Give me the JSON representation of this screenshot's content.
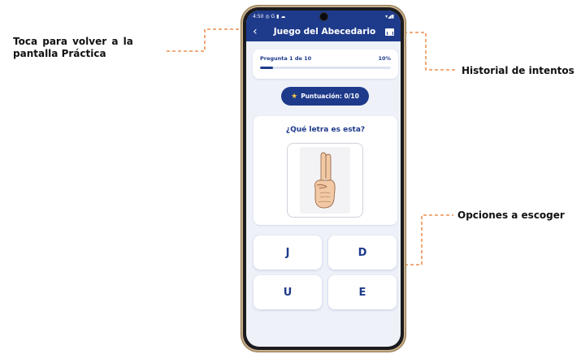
{
  "annotations": {
    "back_line1": "Toca para volver a la",
    "back_line2": "pantalla Práctica",
    "history": "Historial de intentos",
    "options": "Opciones a escoger",
    "guide_color": "#e8792e"
  },
  "status_bar": {
    "time": "4:50",
    "left_icons": "◎ G ▮ ☁",
    "right_icons": "▾◢▮"
  },
  "app_bar": {
    "back_icon": "‹",
    "title": "Juego del Abecedario",
    "history_icon": "bar-chart-icon"
  },
  "progress": {
    "question_label": "Pregunta 1 de 10",
    "percent_label": "10%",
    "fraction": 0.1
  },
  "score": {
    "star": "★",
    "label": "Puntuación: 0/10"
  },
  "question": {
    "prompt": "¿Qué letra es esta?"
  },
  "options": {
    "o1": "J",
    "o2": "D",
    "o3": "U",
    "o4": "E"
  },
  "colors": {
    "primary": "#1e3a8a",
    "background": "#eef1f8",
    "star": "#f6c744",
    "skin": "#f2c9a5"
  }
}
